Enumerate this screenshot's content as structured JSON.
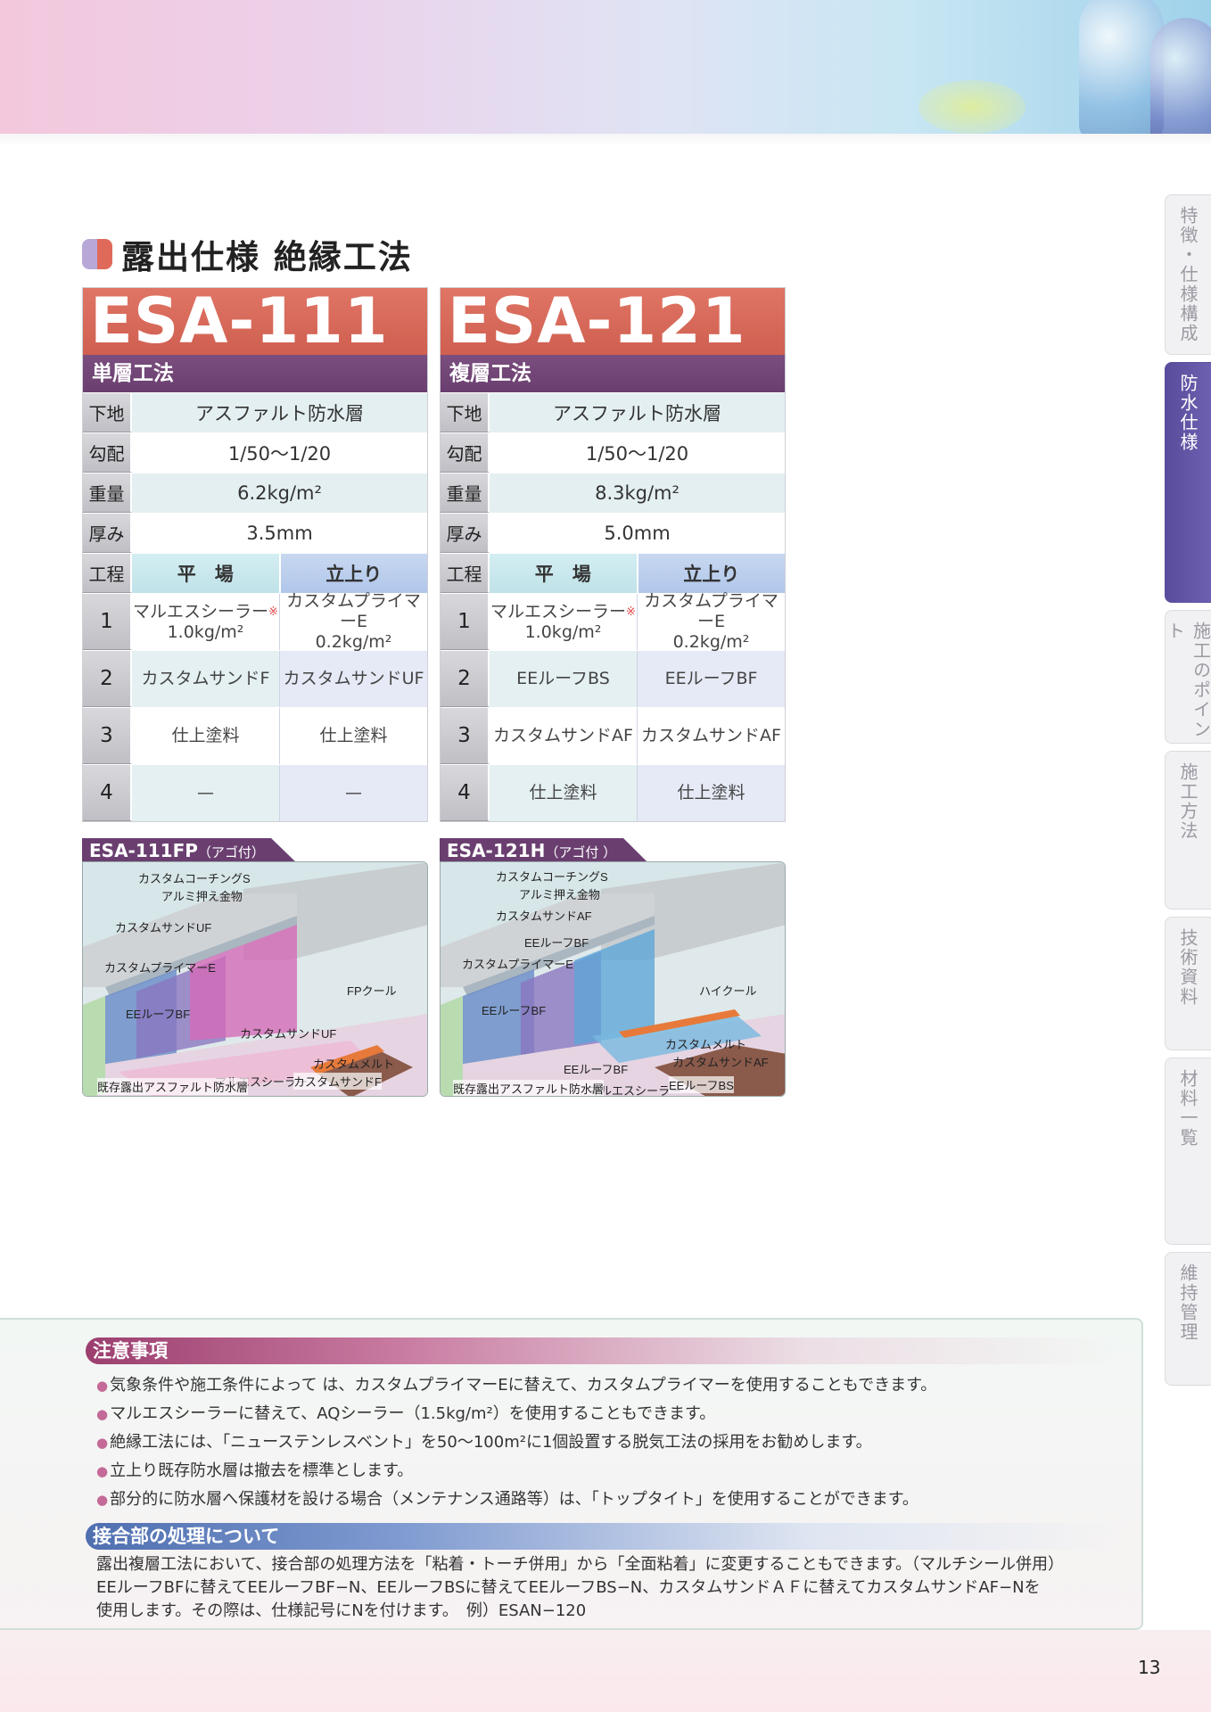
{
  "section_title": "露出仕様 絶縁工法",
  "side_tabs": [
    {
      "label": "特徴・仕様構成",
      "active": false
    },
    {
      "label": "防水仕様",
      "active": true
    },
    {
      "label": "施工のポイント",
      "active": false
    },
    {
      "label": "施工方法",
      "active": false
    },
    {
      "label": "技術資料",
      "active": false
    },
    {
      "label": "材料一覧",
      "active": false
    },
    {
      "label": "維持管理",
      "active": false
    }
  ],
  "specs": [
    {
      "code": "ESA-111",
      "method": "単層工法",
      "base_label": "下地",
      "base": "アスファルト防水層",
      "slope_label": "勾配",
      "slope": "1/50〜1/20",
      "weight_label": "重量",
      "weight": "6.2kg/m²",
      "thickness_label": "厚み",
      "thickness": "3.5mm",
      "process_label": "工程",
      "col_flat": "平　場",
      "col_rise": "立上り",
      "steps": [
        {
          "no": "1",
          "flat": "マルエスシーラー",
          "flat_mark": "※",
          "flat_amount": "1.0kg/m²",
          "rise": "カスタムプライマーE",
          "rise_amount": "0.2kg/m²"
        },
        {
          "no": "2",
          "flat": "カスタムサンドF",
          "flat_mark": "",
          "flat_amount": "",
          "rise": "カスタムサンドUF",
          "rise_amount": ""
        },
        {
          "no": "3",
          "flat": "仕上塗料",
          "flat_mark": "",
          "flat_amount": "",
          "rise": "仕上塗料",
          "rise_amount": ""
        },
        {
          "no": "4",
          "flat": "—",
          "flat_mark": "",
          "flat_amount": "",
          "rise": "—",
          "rise_amount": ""
        }
      ]
    },
    {
      "code": "ESA-121",
      "method": "複層工法",
      "base_label": "下地",
      "base": "アスファルト防水層",
      "slope_label": "勾配",
      "slope": "1/50〜1/20",
      "weight_label": "重量",
      "weight": "8.3kg/m²",
      "thickness_label": "厚み",
      "thickness": "5.0mm",
      "process_label": "工程",
      "col_flat": "平　場",
      "col_rise": "立上り",
      "steps": [
        {
          "no": "1",
          "flat": "マルエスシーラー",
          "flat_mark": "※",
          "flat_amount": "1.0kg/m²",
          "rise": "カスタムプライマーE",
          "rise_amount": "0.2kg/m²"
        },
        {
          "no": "2",
          "flat": "EEルーフBS",
          "flat_mark": "",
          "flat_amount": "",
          "rise": "EEルーフBF",
          "rise_amount": ""
        },
        {
          "no": "3",
          "flat": "カスタムサンドAF",
          "flat_mark": "",
          "flat_amount": "",
          "rise": "カスタムサンドAF",
          "rise_amount": ""
        },
        {
          "no": "4",
          "flat": "仕上塗料",
          "flat_mark": "",
          "flat_amount": "",
          "rise": "仕上塗料",
          "rise_amount": ""
        }
      ]
    }
  ],
  "diagrams": [
    {
      "title": "ESA-111FP",
      "note": "（アゴ付）",
      "labels": [
        "カスタムコーチングS",
        "アルミ押え金物",
        "カスタムサンドUF",
        "カスタムプライマーE",
        "FPクール",
        "EEルーフBF",
        "カスタムサンドUF",
        "カスタムメルト",
        "マルエスシーラー",
        "既存露出アスファルト防水層",
        "カスタムサンドF"
      ]
    },
    {
      "title": "ESA-121H",
      "note": "（アゴ付 ）",
      "labels": [
        "カスタムコーチングS",
        "アルミ押え金物",
        "カスタムサンドAF",
        "EEルーフBF",
        "カスタムプライマーE",
        "ハイクール",
        "EEルーフBF",
        "カスタムメルト",
        "カスタムサンドAF",
        "EEルーフBF",
        "マルエスシーラー",
        "既存露出アスファルト防水層",
        "EEルーフBS"
      ]
    }
  ],
  "notes": {
    "title": "注意事項",
    "items": [
      "気象条件や施工条件によって は、カスタムプライマーEに替えて、カスタムプライマーを使用することもできます。",
      "マルエスシーラーに替えて、AQシーラー（1.5kg/m²）を使用することもできます。",
      "絶縁工法には、「ニューステンレスベント」を50〜100m²に1個設置する脱気工法の採用をお勧めします。",
      "立上り既存防水層は撤去を標準とします。",
      "部分的に防水層へ保護材を設ける場合（メンテナンス通路等）は、「トップタイト」を使用することができます。"
    ]
  },
  "joint": {
    "title": "接合部の処理について",
    "lines": [
      "露出複層工法において、接合部の処理方法を「粘着・トーチ併用」から「全面粘着」に変更することもできます。（マルチシール併用）",
      "EEルーフBFに替えてEEルーフBF−N、EEルーフBSに替えてEEルーフBS−N、カスタムサンドＡＦに替えてカスタムサンドAF−Nを",
      "使用します。その際は、仕様記号にNを付けます。　例）ESAN−120"
    ]
  },
  "page_number": "13"
}
